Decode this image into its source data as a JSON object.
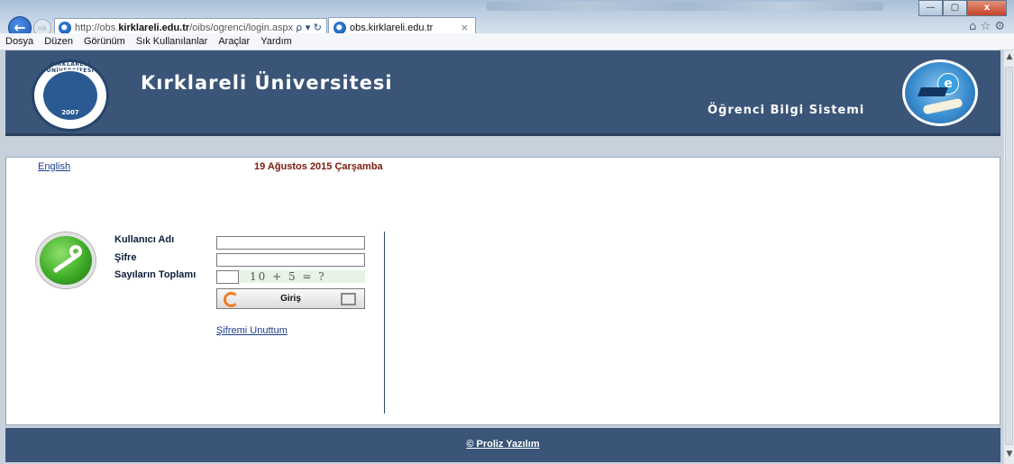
{
  "browser": {
    "url_prefix": "http://obs.",
    "url_domain": "kirklareli.edu.tr",
    "url_path": "/oibs/ogrenci/login.aspx",
    "search_glyph": "ρ ▾ ↻",
    "tab_title": "obs.kirklareli.edu.tr",
    "tab_close": "×",
    "win_min": "—",
    "win_max": "▢",
    "win_close": "x",
    "right_icons": "⌂ ☆ ⚙",
    "back_glyph": "←",
    "fwd_glyph": "⇨"
  },
  "menu": [
    "Dosya",
    "Düzen",
    "Görünüm",
    "Sık Kullanılanlar",
    "Araçlar",
    "Yardım"
  ],
  "header": {
    "university": "Kırklareli Üniversitesi",
    "system": "Öğrenci Bilgi Sistemi",
    "logo_arc": "KIRKLARELİ ÜNİVERSİTESİ",
    "logo_year": "2007",
    "logo_e": "e"
  },
  "content": {
    "english_link": "English",
    "date": "19 Ağustos 2015 Çarşamba",
    "labels": {
      "username": "Kullanıcı Adı",
      "password": "Şifre",
      "sum": "Sayıların Toplamı"
    },
    "username_value": "",
    "password_value": "",
    "sum_value": "",
    "captcha": "10 + 5 = ?",
    "login_button": "Giriş",
    "forgot_link": "Şifremi Unuttum"
  },
  "footer": {
    "link": "© Proliz Yazılım"
  }
}
